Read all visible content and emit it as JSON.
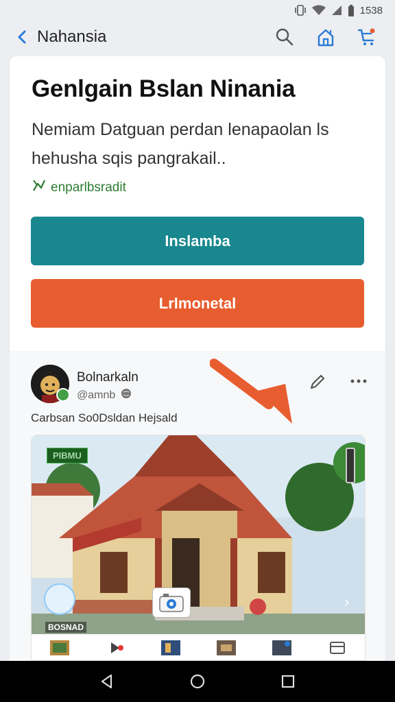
{
  "status_bar": {
    "time": "1538",
    "icons": [
      "vibrate-icon",
      "wifi-icon",
      "signal-icon",
      "battery-icon"
    ]
  },
  "app_bar": {
    "title": "Nahansia",
    "actions": [
      "search-icon",
      "house-icon",
      "cart-icon"
    ]
  },
  "hero": {
    "title": "Genlgain Bslan Ninania",
    "description_line1": "Nemiam Datguan perdan lenapaolan ls",
    "description_line2": "hehusha sqis pangrakail..",
    "tag": "enparlbsradit",
    "primary_button": "Inslamba",
    "secondary_button": "Lrlmonetal"
  },
  "post": {
    "author": "Bolnarkaln",
    "handle": "@amnb",
    "caption": "Carbsan So0Dsldan Hejsald",
    "media_chip": "PIBMU",
    "media_label": "BOSNAD"
  },
  "colors": {
    "primary": "#18878e",
    "secondary": "#e85d2f",
    "accent": "#2a7ad5",
    "arrow": "#e85d2f"
  }
}
